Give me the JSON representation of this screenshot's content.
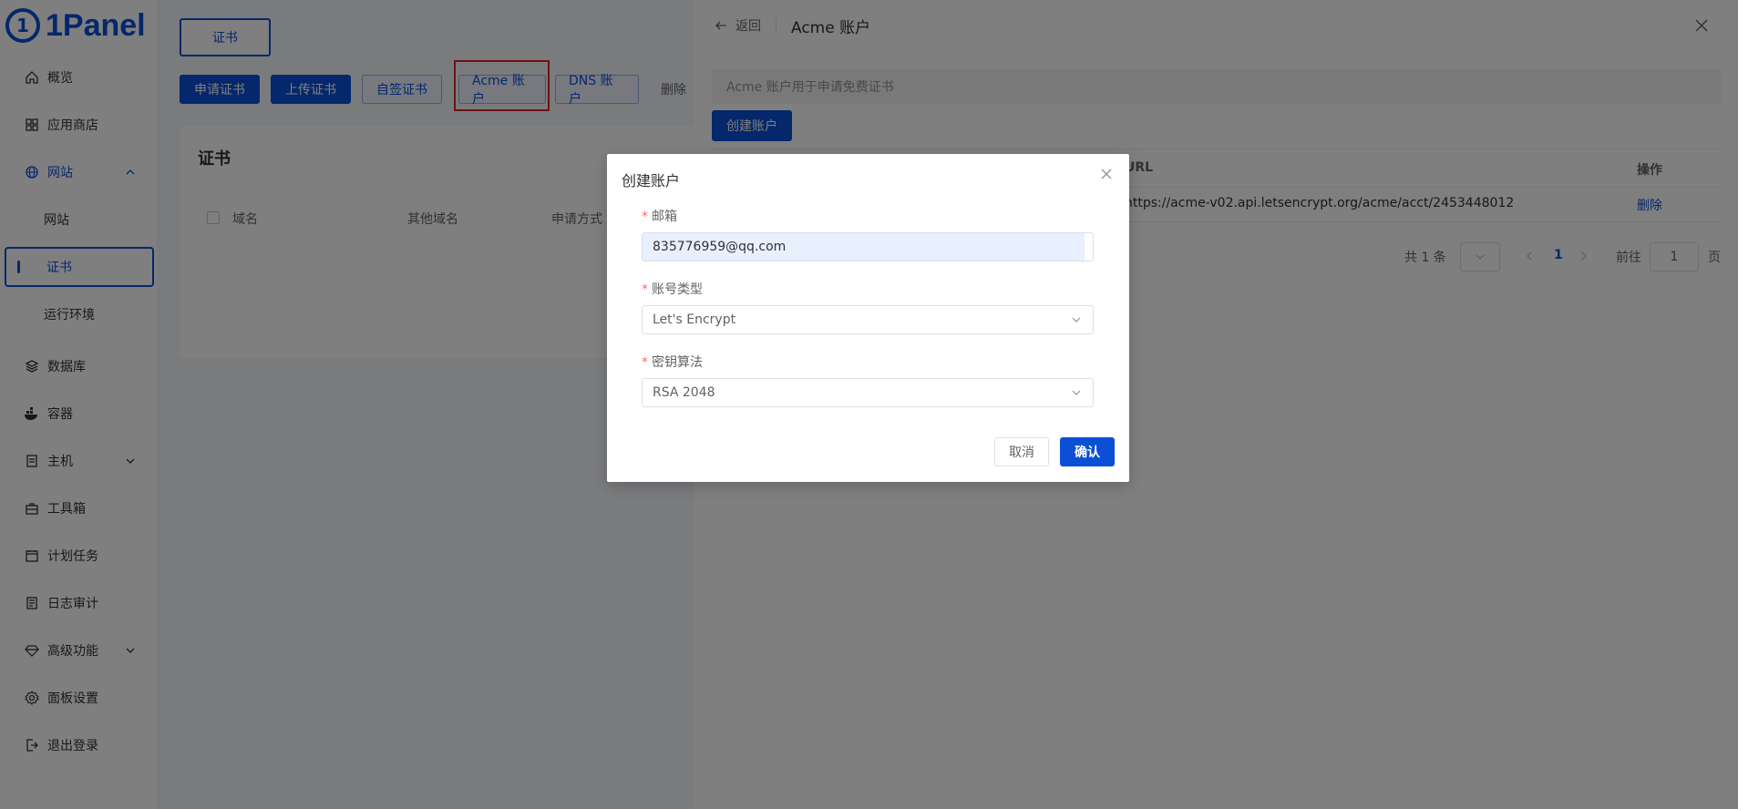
{
  "brand": {
    "logo_glyph": "1",
    "name": "1Panel"
  },
  "sidebar": {
    "items": [
      {
        "label": "概览",
        "icon": "home-icon"
      },
      {
        "label": "应用商店",
        "icon": "grid-icon"
      },
      {
        "label": "网站",
        "icon": "globe-icon"
      },
      {
        "label": "网站"
      },
      {
        "label": "证书"
      },
      {
        "label": "运行环境"
      },
      {
        "label": "数据库",
        "icon": "layers-icon"
      },
      {
        "label": "容器",
        "icon": "docker-icon"
      },
      {
        "label": "主机",
        "icon": "host-icon"
      },
      {
        "label": "工具箱",
        "icon": "toolbox-icon"
      },
      {
        "label": "计划任务",
        "icon": "calendar-icon"
      },
      {
        "label": "日志审计",
        "icon": "log-icon"
      },
      {
        "label": "高级功能",
        "icon": "diamond-icon"
      },
      {
        "label": "面板设置",
        "icon": "gear-icon"
      },
      {
        "label": "退出登录",
        "icon": "logout-icon"
      }
    ]
  },
  "main": {
    "tab_label": "证书",
    "toolbar": {
      "apply_cert": "申请证书",
      "upload_cert": "上传证书",
      "self_signed": "自签证书",
      "acme_account": "Acme 账户",
      "dns_account": "DNS 账户",
      "delete": "删除"
    },
    "card_title": "证书",
    "table_headers": [
      "域名",
      "其他域名",
      "申请方式"
    ]
  },
  "drawer": {
    "back": "返回",
    "title": "Acme 账户",
    "info": "Acme 账户用于申请免费证书",
    "create_button": "创建账户",
    "columns": {
      "url": "URL",
      "action": "操作"
    },
    "row": {
      "url": "https://acme-v02.api.letsencrypt.org/acme/acct/2453448012",
      "action": "删除"
    },
    "pagination": {
      "total": "共 1 条",
      "current_page": "1",
      "goto_label": "前往",
      "goto_value": "1",
      "page_suffix": "页"
    }
  },
  "dialog": {
    "title": "创建账户",
    "required_mark": "*",
    "email": {
      "label": "邮箱",
      "value": "835776959@qq.com"
    },
    "account_type": {
      "label": "账号类型",
      "value": "Let's Encrypt"
    },
    "key_algorithm": {
      "label": "密钥算法",
      "value": "RSA 2048"
    },
    "cancel": "取消",
    "confirm": "确认"
  },
  "colors": {
    "primary": "#0b4fd6",
    "highlight": "#e02424",
    "required": "#f56c6c"
  }
}
